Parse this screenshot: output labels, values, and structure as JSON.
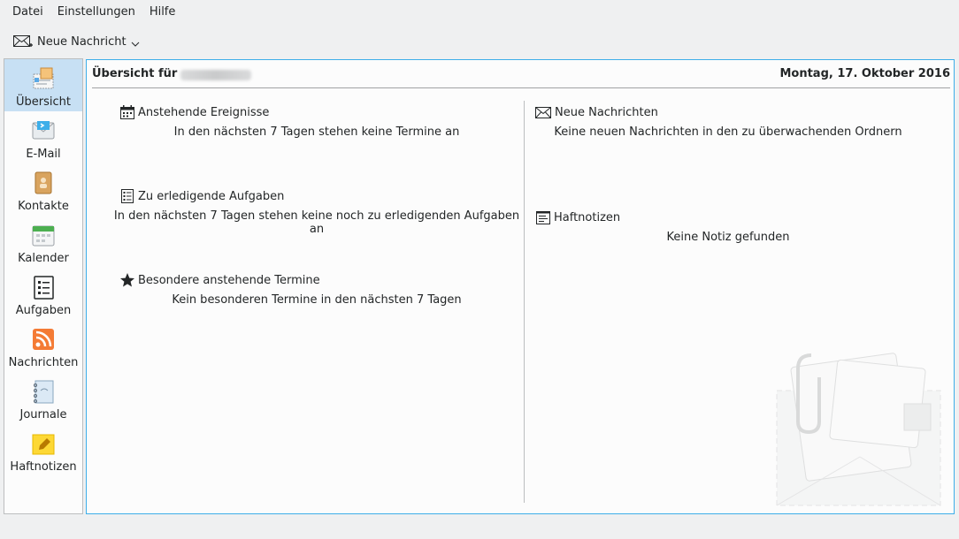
{
  "menubar": {
    "items": [
      "Datei",
      "Einstellungen",
      "Hilfe"
    ]
  },
  "toolbar": {
    "new_message_label": "Neue Nachricht",
    "new_message_icon": "mail-new-icon",
    "dropdown_icon": "chevron-down-icon"
  },
  "sidebar": {
    "items": [
      {
        "label": "Übersicht",
        "icon": "overview-icon",
        "active": true
      },
      {
        "label": "E-Mail",
        "icon": "email-icon"
      },
      {
        "label": "Kontakte",
        "icon": "contacts-icon"
      },
      {
        "label": "Kalender",
        "icon": "calendar-icon"
      },
      {
        "label": "Aufgaben",
        "icon": "tasks-icon"
      },
      {
        "label": "Nachrichten",
        "icon": "rss-feed-icon"
      },
      {
        "label": "Journale",
        "icon": "journal-icon"
      },
      {
        "label": "Haftnotizen",
        "icon": "sticky-note-icon"
      }
    ]
  },
  "panel": {
    "title_prefix": "Übersicht für",
    "date": "Montag, 17. Oktober 2016"
  },
  "sections": {
    "events": {
      "title": "Anstehende Ereignisse",
      "text": "In den nächsten 7 Tagen stehen keine Termine an",
      "icon": "calendar-icon"
    },
    "todos": {
      "title": "Zu erledigende Aufgaben",
      "text": "In den nächsten 7 Tagen stehen keine noch zu erledigenden Aufgaben an",
      "icon": "task-list-icon"
    },
    "special": {
      "title": "Besondere anstehende Termine",
      "text": "Kein besonderen Termine in den nächsten 7 Tagen",
      "icon": "star-icon"
    },
    "messages": {
      "title": "Neue Nachrichten",
      "text": "Keine neuen Nachrichten in den zu überwachenden Ordnern",
      "icon": "envelope-icon"
    },
    "notes": {
      "title": "Haftnotizen",
      "text": "Keine Notiz gefunden",
      "icon": "notes-icon"
    }
  },
  "colors": {
    "accent": "#3daee9",
    "active_bg": "#c7e0f4",
    "background": "#eff0f1",
    "panel_bg": "#fcfcfc"
  }
}
